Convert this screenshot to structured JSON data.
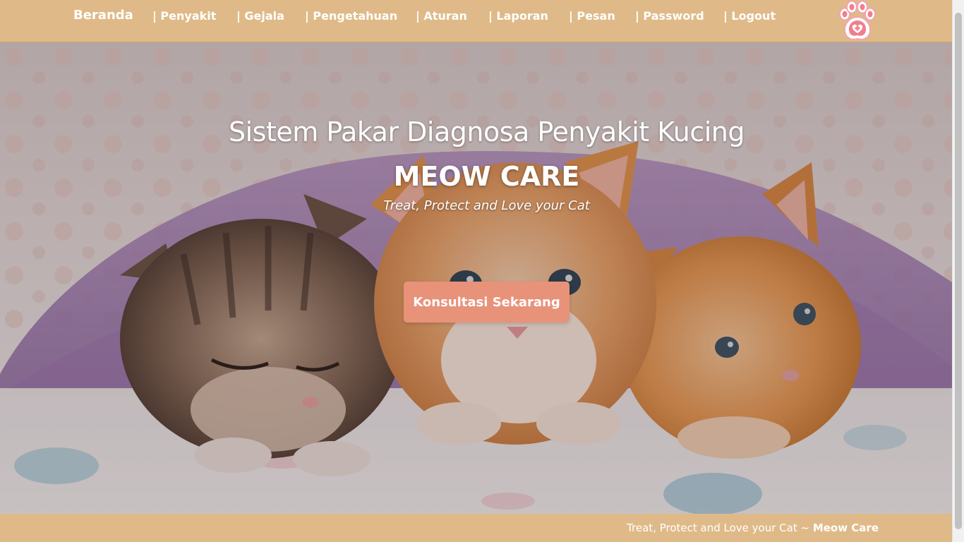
{
  "nav": {
    "brand": "Beranda",
    "items": [
      {
        "label": "| Penyakit",
        "name": "nav-penyakit"
      },
      {
        "label": "| Gejala",
        "name": "nav-gejala"
      },
      {
        "label": "| Pengetahuan",
        "name": "nav-pengetahuan"
      },
      {
        "label": "| Aturan",
        "name": "nav-aturan"
      },
      {
        "label": "| Laporan",
        "name": "nav-laporan"
      },
      {
        "label": "| Pesan",
        "name": "nav-pesan"
      },
      {
        "label": "| Password",
        "name": "nav-password"
      },
      {
        "label": "| Logout",
        "name": "nav-logout"
      }
    ],
    "logo_icon": "paw-icon"
  },
  "hero": {
    "title": "Sistem Pakar Diagnosa Penyakit Kucing",
    "brand": "MEOW CARE",
    "tagline": "Treat, Protect and Love your Cat",
    "cta_label": "Konsultasi Sekarang",
    "image": "three-kittens-under-blanket"
  },
  "footer": {
    "text": "Treat, Protect and Love your Cat ~ ",
    "brand": "Meow Care"
  },
  "colors": {
    "navbar": "#dfba88",
    "cta": "#e8927a",
    "text": "#ffffff"
  }
}
